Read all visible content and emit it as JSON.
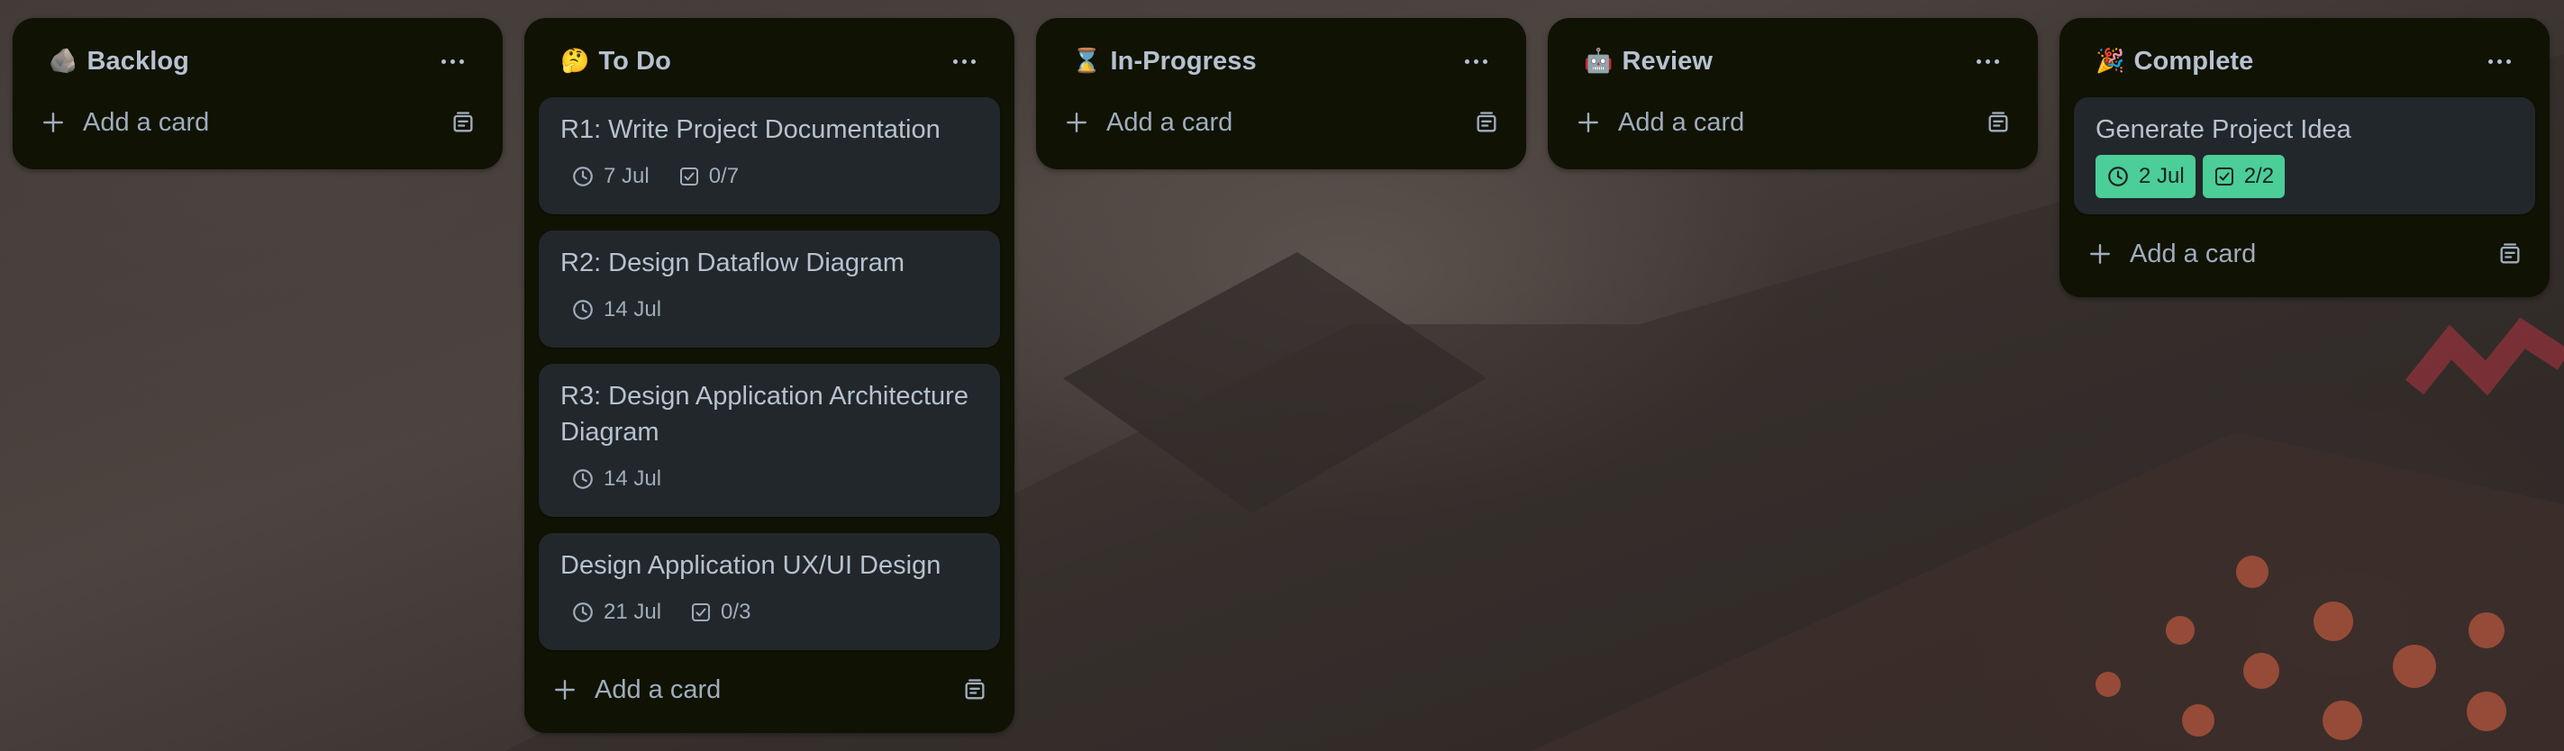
{
  "colors": {
    "list_bg": "#101204",
    "card_bg": "#22272b",
    "text": "#b6c2cf",
    "subtle_text": "#9fadbc",
    "complete_badge": "#4bce97"
  },
  "board": {
    "lists": [
      {
        "emoji": "🪨",
        "name": "Backlog",
        "add_card_label": "Add a card",
        "cards": []
      },
      {
        "emoji": "🤔",
        "name": "To Do",
        "add_card_label": "Add a card",
        "cards": [
          {
            "title": "R1: Write Project Documentation",
            "due": "7 Jul",
            "checklist": "0/7",
            "complete": false
          },
          {
            "title": "R2: Design Dataflow Diagram",
            "due": "14 Jul",
            "checklist": null,
            "complete": false
          },
          {
            "title": "R3: Design Application Architecture Diagram",
            "due": "14 Jul",
            "checklist": null,
            "complete": false
          },
          {
            "title": "Design Application UX/UI Design",
            "due": "21 Jul",
            "checklist": "0/3",
            "complete": false
          }
        ]
      },
      {
        "emoji": "⌛",
        "name": "In-Progress",
        "add_card_label": "Add a card",
        "cards": []
      },
      {
        "emoji": "🤖",
        "name": "Review",
        "add_card_label": "Add a card",
        "cards": []
      },
      {
        "emoji": "🎉",
        "name": "Complete",
        "add_card_label": "Add a card",
        "cards": [
          {
            "title": "Generate Project Idea",
            "due": "2 Jul",
            "checklist": "2/2",
            "complete": true
          }
        ]
      }
    ]
  },
  "icons": {
    "more": "more-horizontal-icon",
    "add": "plus-icon",
    "template": "card-template-icon",
    "due": "clock-icon",
    "checklist": "checklist-icon"
  }
}
